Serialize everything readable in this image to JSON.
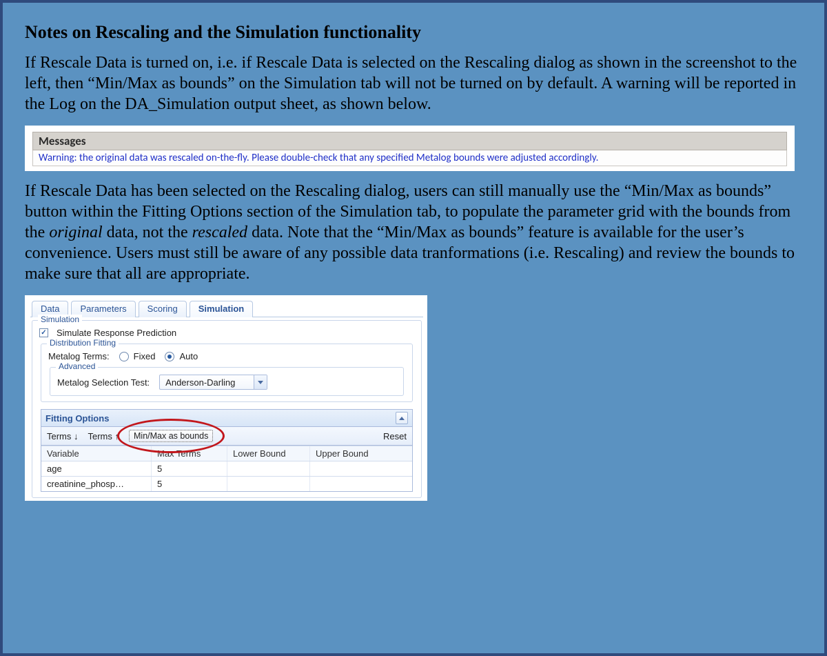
{
  "title": "Notes on Rescaling and the Simulation functionality",
  "para1": "If Rescale Data is turned on, i.e. if Rescale Data is selected on the Rescaling dialog as shown in the screenshot to the left, then “Min/Max as bounds” on the Simulation tab will not be turned on by default.  A warning will be reported in the Log on the DA_Simulation output sheet, as shown below.",
  "messages": {
    "header": "Messages",
    "warning": "Warning: the original data was rescaled on-the-fly. Please double-check that any specified Metalog bounds were adjusted accordingly."
  },
  "para2_pre": "If Rescale Data has been selected on the Rescaling dialog, users can still manually use the “Min/Max as bounds” button within the Fitting Options section of the Simulation tab, to populate the parameter grid with the bounds from the ",
  "para2_em1": "original",
  "para2_mid": " data, not the ",
  "para2_em2": "rescaled",
  "para2_post": " data.  Note that the “Min/Max as bounds” feature is available for the user’s convenience.  Users must still be aware of any possible data tranformations (i.e. Rescaling) and review the bounds to make sure that all are appropriate.",
  "sim": {
    "tabs": {
      "data": "Data",
      "parameters": "Parameters",
      "scoring": "Scoring",
      "simulation": "Simulation"
    },
    "group_simulation": "Simulation",
    "chk_simulate_label": "Simulate Response Prediction",
    "group_distribution": "Distribution Fitting",
    "metalog_terms_label": "Metalog Terms:",
    "metalog_fixed": "Fixed",
    "metalog_auto": "Auto",
    "group_advanced": "Advanced",
    "selection_test_label": "Metalog Selection Test:",
    "selection_test_value": "Anderson-Darling",
    "fitting_options_header": "Fitting Options",
    "terms_down": "Terms ↓",
    "terms_up": "Terms ↑",
    "minmax_btn": "Min/Max as bounds",
    "reset": "Reset",
    "grid_headers": {
      "variable": "Variable",
      "max_terms": "Max Terms",
      "lower_bound": "Lower Bound",
      "upper_bound": "Upper Bound"
    },
    "grid_rows": [
      {
        "variable": "age",
        "max_terms": "5",
        "lower_bound": "",
        "upper_bound": ""
      },
      {
        "variable": "creatinine_phosp…",
        "max_terms": "5",
        "lower_bound": "",
        "upper_bound": ""
      }
    ]
  }
}
